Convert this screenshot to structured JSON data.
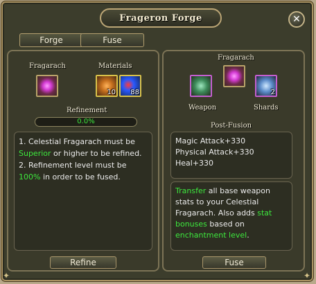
{
  "window": {
    "title": "Frageron Forge"
  },
  "tabs": [
    {
      "label": "Forge"
    },
    {
      "label": "Fuse"
    }
  ],
  "left": {
    "item_label": "Fragarach",
    "materials_label": "Materials",
    "materials": [
      {
        "icon": "orange-gem-icon",
        "qty": "10"
      },
      {
        "icon": "blue-orb-icon",
        "qty": "88"
      }
    ],
    "refinement_label": "Refinement",
    "refinement_percent": "0.0%",
    "refinement_value": 0,
    "info": {
      "line1_a": "1. Celestial Fragarach must be ",
      "line1_b": "Superior",
      "line1_c": " or higher to be refined.",
      "line2_a": "2. Refinement level must be ",
      "line2_b": "100%",
      "line2_c": " in order to be fused."
    },
    "refine_button": "Refine"
  },
  "right": {
    "item_label": "Fragarach",
    "weapon_label": "Weapon",
    "shards_label": "Shards",
    "shards_qty": "2",
    "post_fusion_label": "Post-Fusion",
    "stats": [
      "Magic Attack+330",
      "Physical Attack+330",
      "Heal+330"
    ],
    "desc": {
      "a": "Transfer",
      "b": " all base weapon stats to your Celestial Fragarach. Also adds ",
      "c": "stat bonuses",
      "d": " based on ",
      "e": "enchantment level",
      "f": "."
    },
    "fuse_button": "Fuse"
  },
  "colors": {
    "highlight": "#3de83d",
    "border": "#b9a36a",
    "panel": "#3a3a2a"
  }
}
